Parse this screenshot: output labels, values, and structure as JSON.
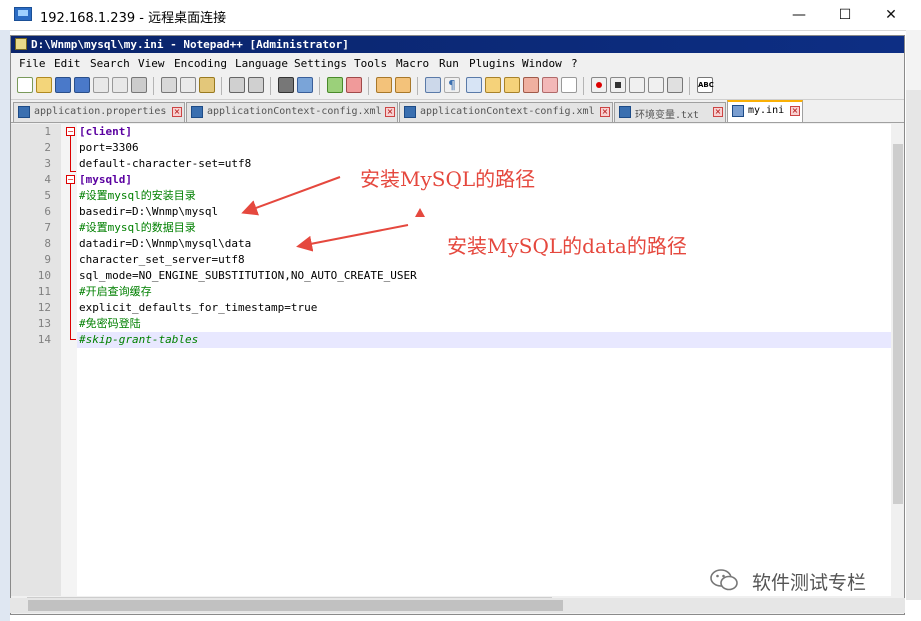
{
  "rdp_window": {
    "title": "192.168.1.239 - 远程桌面连接",
    "minimize": "—",
    "maximize": "☐",
    "close": "✕"
  },
  "notepad": {
    "title": "D:\\Wnmp\\mysql\\my.ini - Notepad++ [Administrator]",
    "menu": [
      "File",
      "Edit",
      "Search",
      "View",
      "Encoding",
      "Language",
      "Settings",
      "Tools",
      "Macro",
      "Run",
      "Plugins",
      "Window",
      "?"
    ],
    "tabs": [
      {
        "label": "application.properties",
        "active": false
      },
      {
        "label": "applicationContext-config.xml",
        "active": false
      },
      {
        "label": "applicationContext-config.xml",
        "active": false
      },
      {
        "label": "环境变量.txt",
        "active": false
      },
      {
        "label": "my.ini",
        "active": true
      }
    ],
    "lines": [
      {
        "n": "1",
        "text": "[client]",
        "kind": "section"
      },
      {
        "n": "2",
        "text": "port=3306",
        "kind": "kv"
      },
      {
        "n": "3",
        "text": "default-character-set=utf8",
        "kind": "kv"
      },
      {
        "n": "4",
        "text": "[mysqld]",
        "kind": "section"
      },
      {
        "n": "5",
        "text": "#设置mysql的安装目录",
        "kind": "comment"
      },
      {
        "n": "6",
        "text": "basedir=D:\\Wnmp\\mysql",
        "kind": "kv"
      },
      {
        "n": "7",
        "text": "#设置mysql的数据目录",
        "kind": "comment"
      },
      {
        "n": "8",
        "text": "datadir=D:\\Wnmp\\mysql\\data",
        "kind": "kv"
      },
      {
        "n": "9",
        "text": "character_set_server=utf8",
        "kind": "kv"
      },
      {
        "n": "10",
        "text": "sql_mode=NO_ENGINE_SUBSTITUTION,NO_AUTO_CREATE_USER",
        "kind": "kv"
      },
      {
        "n": "11",
        "text": "#开启查询缓存",
        "kind": "comment"
      },
      {
        "n": "12",
        "text": "explicit_defaults_for_timestamp=true",
        "kind": "kv"
      },
      {
        "n": "13",
        "text": "#免密码登陆",
        "kind": "comment"
      },
      {
        "n": "14",
        "text": "#skip-grant-tables",
        "kind": "comment-italic"
      }
    ],
    "current_line": "14"
  },
  "annotations": {
    "install_path": "安装MySQL的路径",
    "data_path": "安装MySQL的data的路径"
  },
  "watermark": {
    "text": "软件测试专栏"
  },
  "colors": {
    "annotation": "#e5483e",
    "section": "#5a00a0",
    "comment": "#008000",
    "title_bar": "#0a246a"
  }
}
